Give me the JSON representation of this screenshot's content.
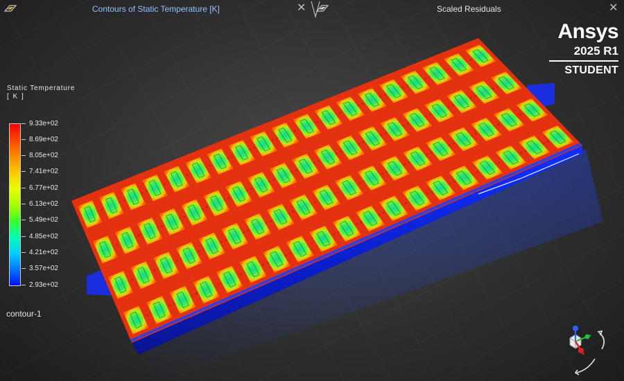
{
  "tabs": [
    {
      "title": "Contours of Static Temperature [K]",
      "close": "✕"
    },
    {
      "title": "Scaled Residuals",
      "close": "✕"
    }
  ],
  "brand": {
    "name": "Ansys",
    "version": "2025 R1",
    "edition": "STUDENT"
  },
  "legend": {
    "title": "Static Temperature",
    "unit": "[ K ]",
    "labels": [
      "9.33e+02",
      "8.69e+02",
      "8.05e+02",
      "7.41e+02",
      "6.77e+02",
      "6.13e+02",
      "5.49e+02",
      "4.85e+02",
      "4.21e+02",
      "3.57e+02",
      "2.93e+02"
    ],
    "colors": [
      "#ff0000",
      "#ff4600",
      "#ff8a00",
      "#ffc800",
      "#e8ff00",
      "#aaff00",
      "#3cff28",
      "#00ffb0",
      "#00d0ff",
      "#0078ff",
      "#0010ff"
    ]
  },
  "contour_name": "contour-1",
  "icons": {
    "tab_left": "graphics-window-icon",
    "tab_right": "graphics-window-icon",
    "triad": "axis-triad-icon"
  }
}
